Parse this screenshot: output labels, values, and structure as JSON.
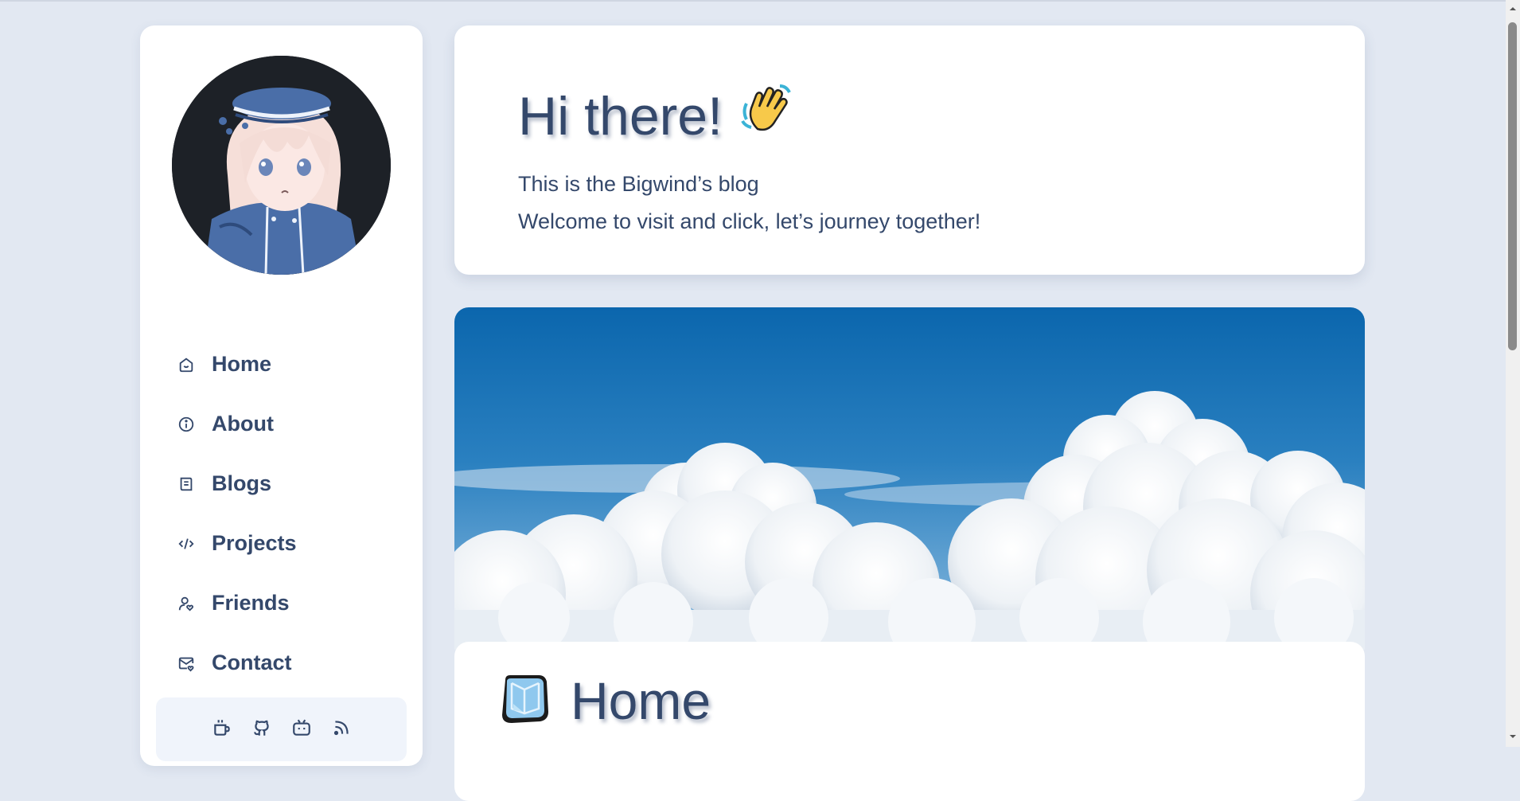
{
  "colors": {
    "page_bg": "#e2e8f2",
    "card_bg": "#ffffff",
    "text": "#34486b",
    "social_bg": "#f0f4fb",
    "sky_top": "#0b66ad",
    "sky_bottom": "#7fb2da"
  },
  "sidebar": {
    "avatar_alt": "anime character avatar",
    "nav": [
      {
        "label": "Home",
        "icon": "home-icon"
      },
      {
        "label": "About",
        "icon": "info-icon"
      },
      {
        "label": "Blogs",
        "icon": "book-icon"
      },
      {
        "label": "Projects",
        "icon": "code-icon"
      },
      {
        "label": "Friends",
        "icon": "user-heart-icon"
      },
      {
        "label": "Contact",
        "icon": "mail-heart-icon"
      }
    ],
    "social": [
      "coffee-icon",
      "github-icon",
      "bilibili-icon",
      "rss-icon"
    ]
  },
  "hero": {
    "title": "Hi there!",
    "emoji": "👋",
    "line1": "This is the Bigwind’s blog",
    "line2": "Welcome to visit and click, let’s journey together!"
  },
  "home_card": {
    "title": "Home",
    "icon": "ice-cube-icon"
  }
}
